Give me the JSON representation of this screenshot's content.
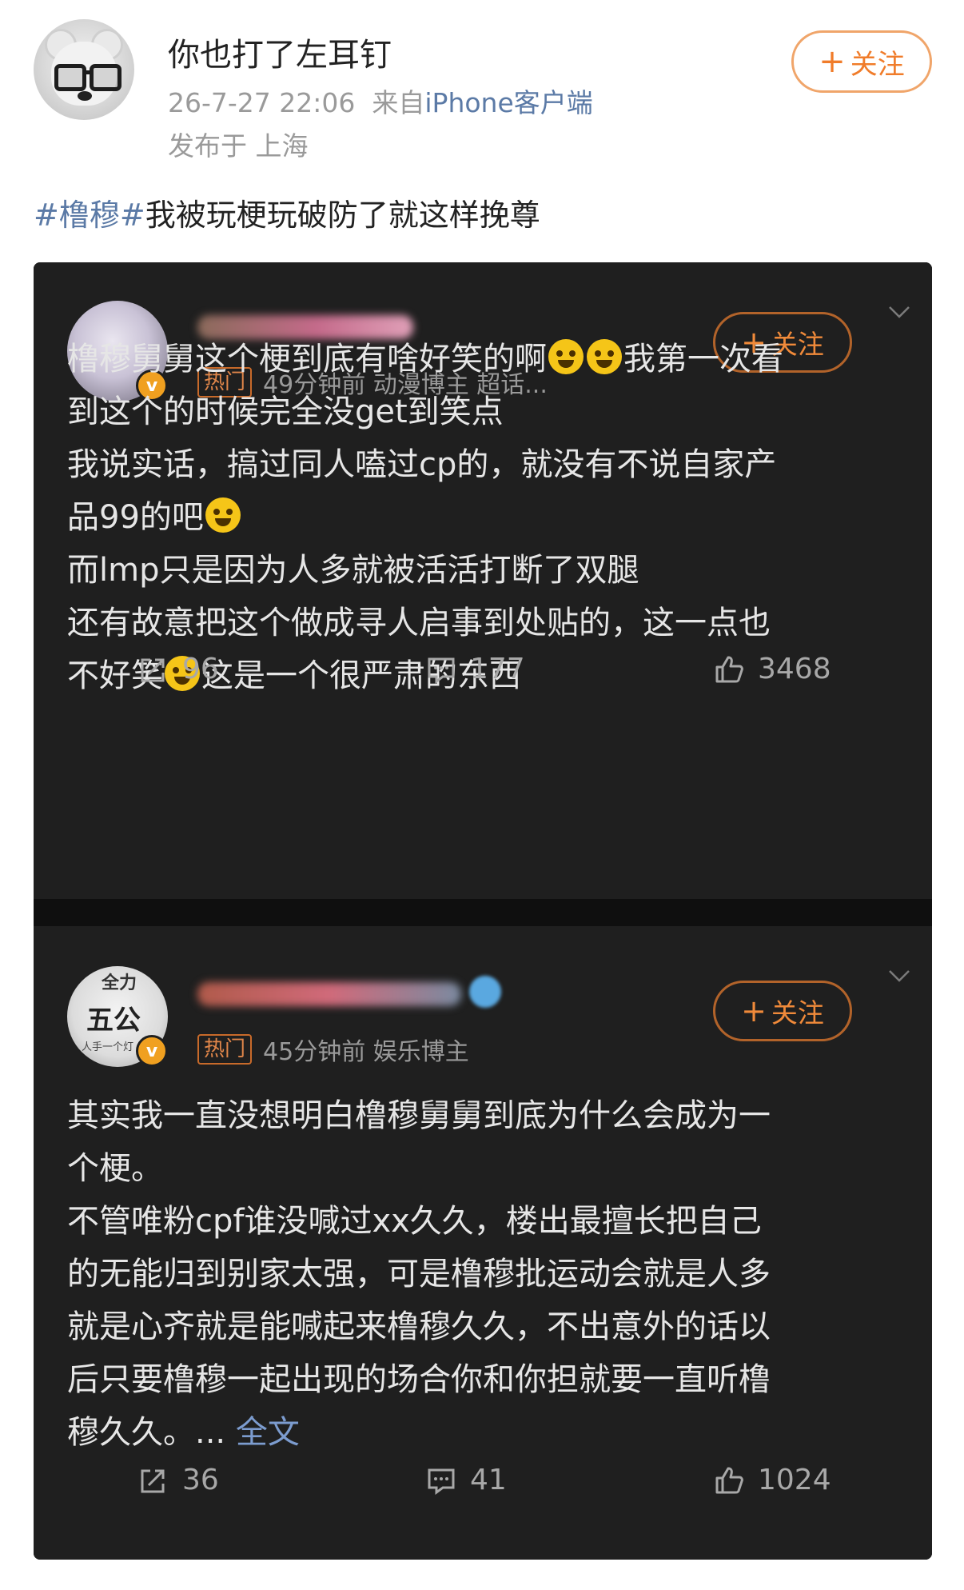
{
  "post": {
    "username": "你也打了左耳钉",
    "time": "26-7-27 22:06",
    "source_prefix": "来自",
    "source": "iPhone客户端",
    "location": "发布于 上海",
    "follow_label": "关注",
    "hashtag": "#橹穆#",
    "text": "我被玩梗玩破防了就这样挽尊"
  },
  "comments": [
    {
      "hot_label": "热门",
      "meta": "49分钟前  动漫博主 超话...",
      "follow_label": "关注",
      "lines": [
        "橹穆舅舅这个梗到底有啥好笑的啊",
        "我第一次看",
        "到这个的时候完全没get到笑点",
        "我说实话，搞过同人嗑过cp的，就没有不说自家产",
        "品99的吧",
        "而lmp只是因为人多就被活活打断了双腿",
        "还有故意把这个做成寻人启事到处贴的，这一点也",
        "不好笑",
        "这是一个很严肃的东西"
      ],
      "reposts": "96",
      "comments": "177",
      "likes": "3468"
    },
    {
      "avatar_text_top": "全力",
      "avatar_text_mid": "五公",
      "avatar_text_bottom": "人手一个灯",
      "hot_label": "热门",
      "meta": "45分钟前  娱乐博主",
      "follow_label": "关注",
      "lines": [
        "其实我一直没想明白橹穆舅舅到底为什么会成为一",
        "个梗。",
        "不管唯粉cpf谁没喊过xx久久，楼出最擅长把自己",
        "的无能归到别家太强，可是橹穆批运动会就是人多",
        "就是心齐就是能喊起来橹穆久久，不出意外的话以",
        "后只要橹穆一起出现的场合你和你担就要一直听橹",
        "穆久久。..."
      ],
      "more_label": "全文",
      "reposts": "36",
      "comments": "41",
      "likes": "1024"
    }
  ]
}
